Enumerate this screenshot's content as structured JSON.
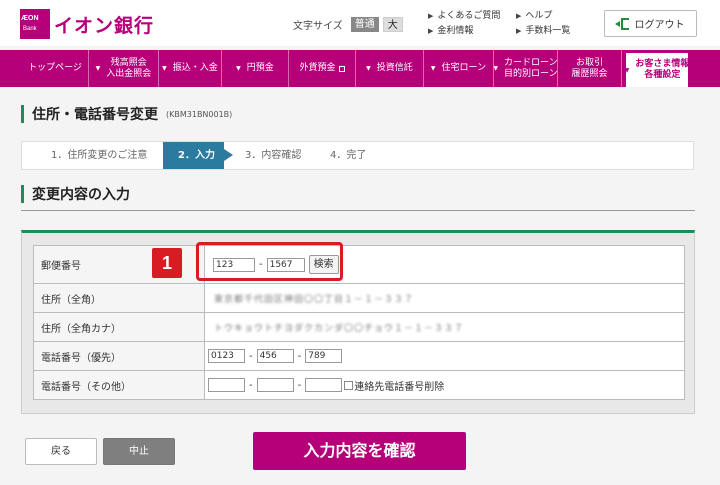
{
  "header": {
    "logo_mark_top": "ÆON",
    "logo_mark_bottom": "Bank",
    "logo_text": "イオン銀行",
    "font_size_label": "文字サイズ",
    "font_size_normal": "普通",
    "font_size_large": "大",
    "links_col1": [
      "よくあるご質問",
      "金利情報"
    ],
    "links_col2": [
      "ヘルプ",
      "手数料一覧"
    ],
    "logout_label": "ログアウト"
  },
  "nav": {
    "items": [
      {
        "label": "トップページ"
      },
      {
        "label": "残高照会",
        "label2": "入出金照会"
      },
      {
        "label": "振込・入金"
      },
      {
        "label": "円預金"
      },
      {
        "label": "外貨預金"
      },
      {
        "label": "投資信託"
      },
      {
        "label": "住宅ローン"
      },
      {
        "label": "カードローン",
        "label2": "目的別ローン"
      },
      {
        "label": "お取引",
        "label2": "履歴照会"
      },
      {
        "label": "お客さま情報",
        "label2": "各種設定"
      }
    ]
  },
  "page": {
    "title": "住所・電話番号変更",
    "code": "(KBM31BN001B)",
    "steps": [
      "1．住所変更のご注意",
      "2．入力",
      "3．内容確認",
      "4．完了"
    ],
    "section_title": "変更内容の入力"
  },
  "form": {
    "rows": [
      {
        "label": "郵便番号"
      },
      {
        "label": "住所（全角）",
        "masked": "東京都千代田区神田〇〇丁目１－１－３３７"
      },
      {
        "label": "住所（全角カナ）",
        "masked": "トウキョウトチヨダクカンダ〇〇チョウ１－１－３３７"
      },
      {
        "label": "電話番号（優先）"
      },
      {
        "label": "電話番号（その他）"
      }
    ],
    "postal1": "123",
    "postal2": "1567",
    "search_label": "検索",
    "phone1": "0123",
    "phone2": "456",
    "phone3": "789",
    "delete_checkbox_label": "連絡先電話番号削除",
    "dash": "-"
  },
  "annotation": {
    "badge_number": "1",
    "color": "#d81c23"
  },
  "buttons": {
    "back": "戻る",
    "cancel": "中止",
    "confirm": "入力内容を確認"
  },
  "colors": {
    "brand": "#b6007a",
    "accent_green": "#1e8c5a",
    "step_active": "#2b7aa0"
  }
}
